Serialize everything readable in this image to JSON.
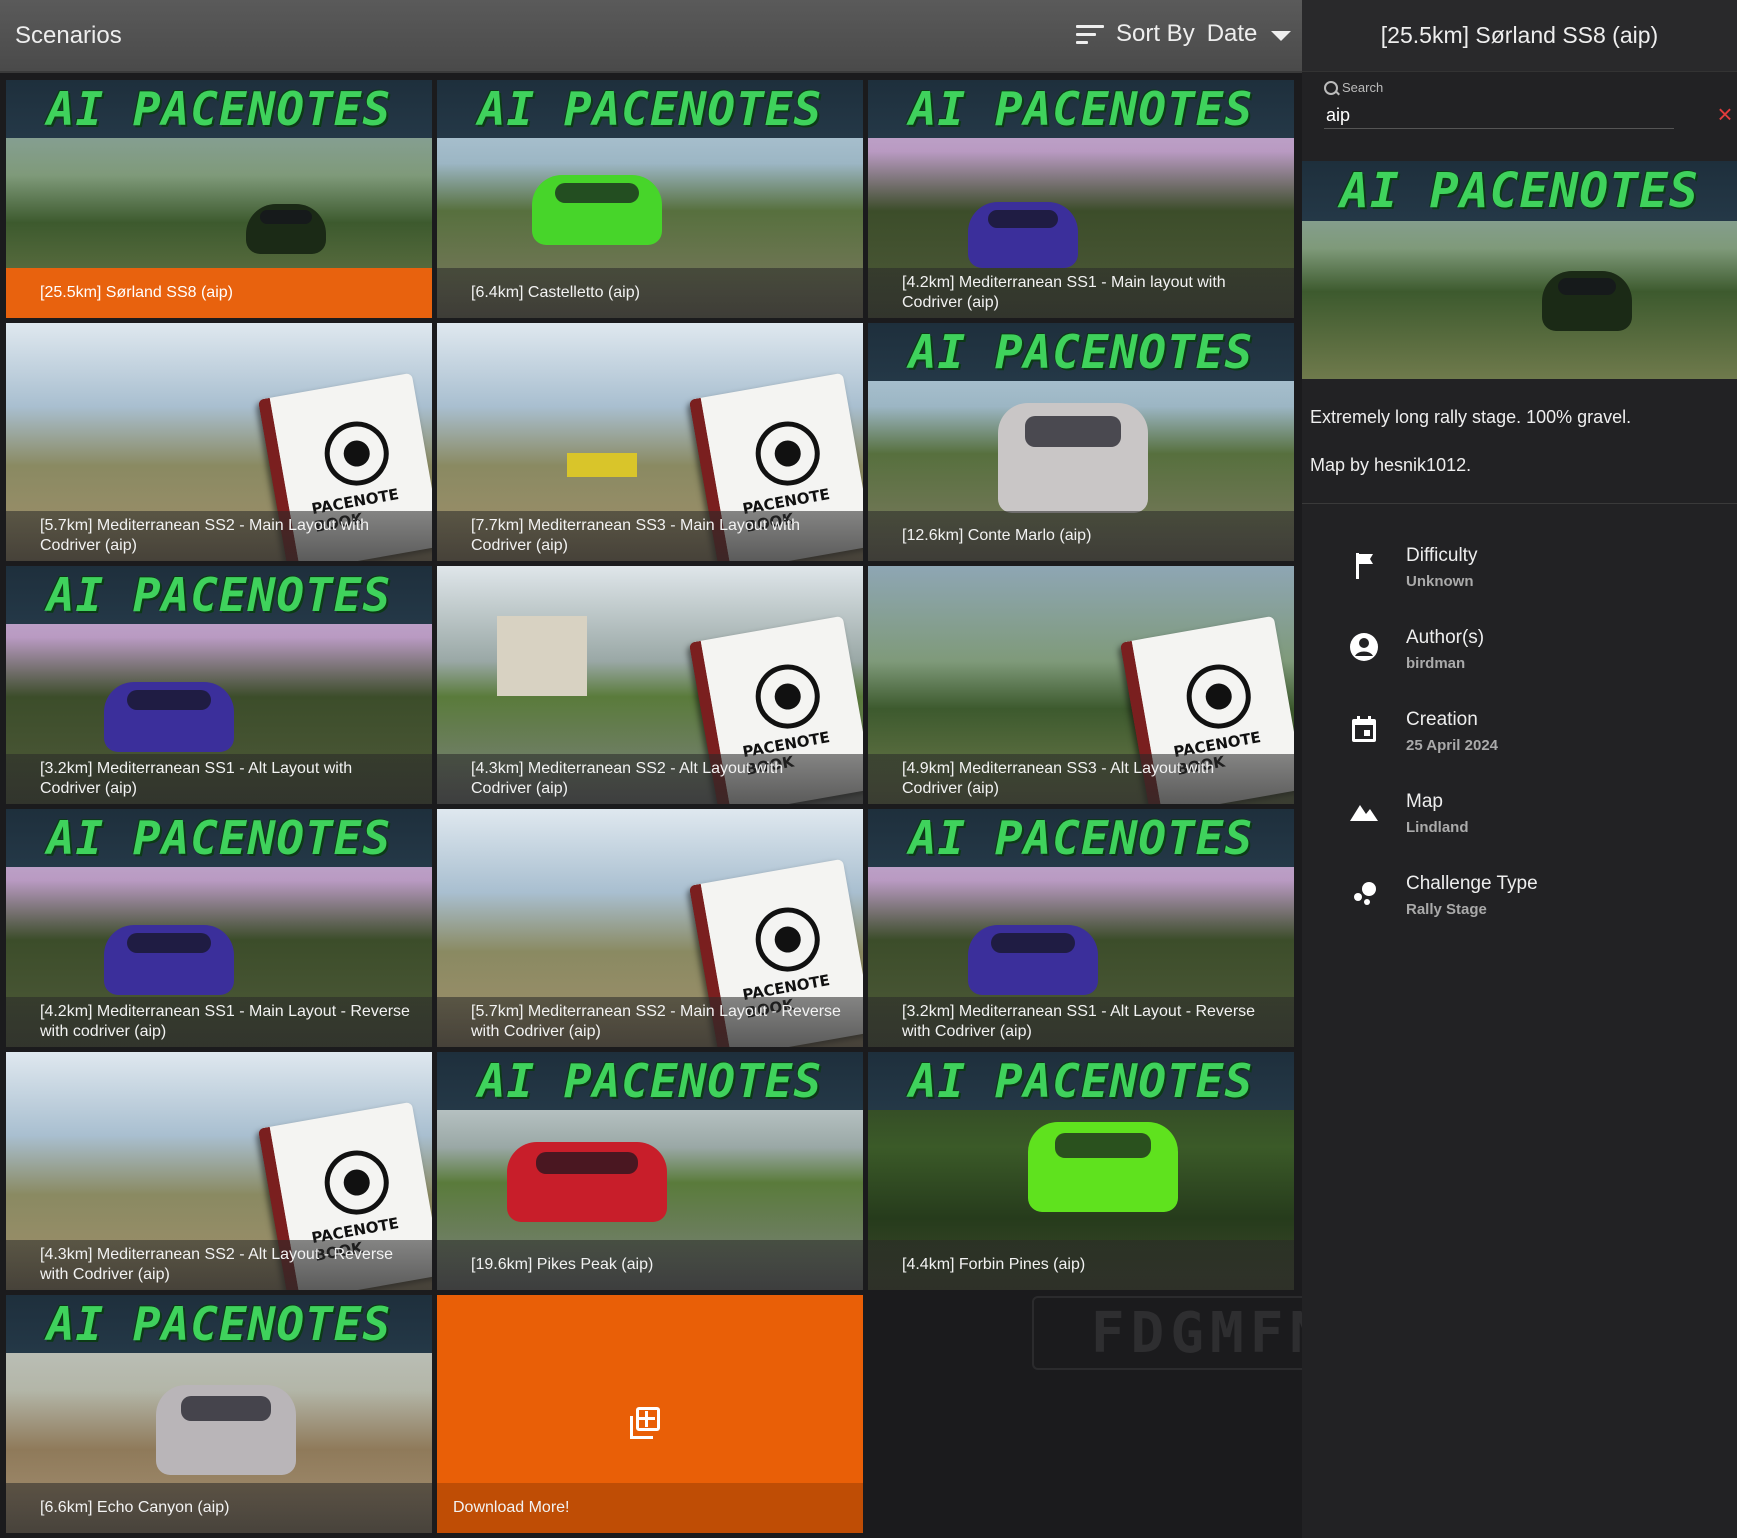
{
  "header": {
    "title": "Scenarios",
    "sort_label": "Sort By",
    "sort_value": "Date"
  },
  "tiles": [
    {
      "banner": "AI PACENOTES",
      "caption": "[25.5km] Sørland SS8 (aip)"
    },
    {
      "banner": "AI PACENOTES",
      "caption": "[6.4km] Castelletto (aip)"
    },
    {
      "banner": "AI PACENOTES",
      "caption": "[4.2km] Mediterranean SS1 - Main layout with Codriver (aip)"
    },
    {
      "book": "PACENOTE BOOK",
      "caption": "[5.7km] Mediterranean SS2 - Main Layout with Codriver (aip)"
    },
    {
      "book": "PACENOTE BOOK",
      "caption": "[7.7km] Mediterranean SS3 - Main Layout with Codriver (aip)"
    },
    {
      "banner": "AI PACENOTES",
      "caption": "[12.6km] Conte Marlo (aip)"
    },
    {
      "banner": "AI PACENOTES",
      "caption": "[3.2km] Mediterranean SS1 - Alt Layout with Codriver (aip)"
    },
    {
      "book": "PACENOTE BOOK",
      "caption": "[4.3km] Mediterranean SS2 - Alt Layout with Codriver (aip)"
    },
    {
      "book": "PACENOTE BOOK",
      "caption": "[4.9km] Mediterranean SS3 - Alt Layout with Codriver (aip)"
    },
    {
      "banner": "AI PACENOTES",
      "caption": "[4.2km] Mediterranean SS1 - Main Layout - Reverse with codriver (aip)"
    },
    {
      "book": "PACENOTE BOOK",
      "caption": "[5.7km] Mediterranean SS2 - Main Layout - Reverse with Codriver (aip)"
    },
    {
      "banner": "AI PACENOTES",
      "caption": "[3.2km] Mediterranean SS1 - Alt Layout - Reverse with Codriver (aip)"
    },
    {
      "book": "PACENOTE BOOK",
      "caption": "[4.3km] Mediterranean SS2 - Alt Layout - Reverse with Codriver (aip)"
    },
    {
      "banner": "AI PACENOTES",
      "caption": "[19.6km] Pikes Peak (aip)"
    },
    {
      "banner": "AI PACENOTES",
      "caption": "[4.4km] Forbin Pines (aip)"
    },
    {
      "banner": "AI PACENOTES",
      "caption": "[6.6km] Echo Canyon (aip)"
    }
  ],
  "download": {
    "label": "Download More!",
    "icon": "add-to-library-icon"
  },
  "panel": {
    "title": "[25.5km] Sørland SS8 (aip)",
    "search_label": "Search",
    "search_value": "aip",
    "clear_icon": "×",
    "preview_banner": "AI PACENOTES",
    "description": [
      "Extremely long rally stage. 100% gravel.",
      "Map by hesnik1012."
    ],
    "info": [
      {
        "key": "Difficulty",
        "value": "Unknown",
        "icon": "flag-icon"
      },
      {
        "key": "Author(s)",
        "value": "birdman",
        "icon": "account-icon"
      },
      {
        "key": "Creation",
        "value": "25 April 2024",
        "icon": "calendar-icon"
      },
      {
        "key": "Map",
        "value": "Lindland",
        "icon": "mountain-icon"
      },
      {
        "key": "Challenge Type",
        "value": "Rally Stage",
        "icon": "bubbles-icon"
      }
    ]
  },
  "colors": {
    "accent": "#e8620e",
    "banner_green": "#3fd25c"
  },
  "watermark": "FDGMFN"
}
